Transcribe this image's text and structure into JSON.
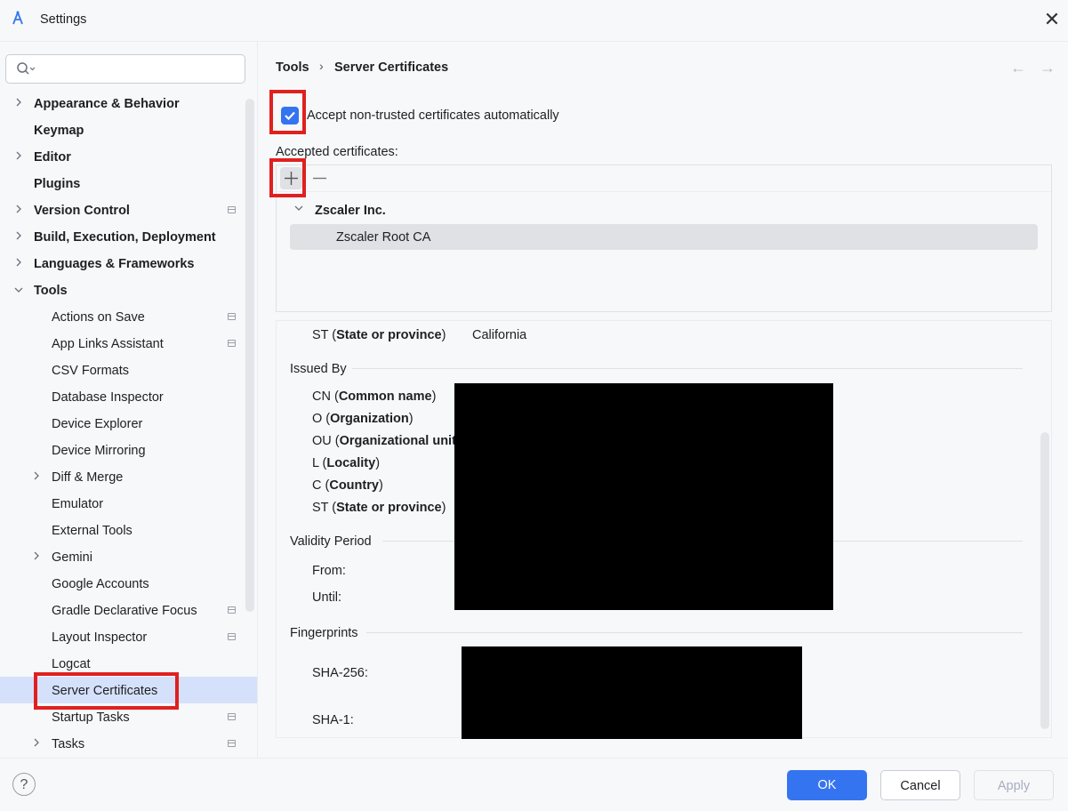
{
  "window": {
    "title": "Settings"
  },
  "search": {
    "placeholder": ""
  },
  "sidebar": {
    "items": [
      {
        "label": "Appearance & Behavior",
        "bold": true,
        "chevron": "right"
      },
      {
        "label": "Keymap",
        "bold": true
      },
      {
        "label": "Editor",
        "bold": true,
        "chevron": "right"
      },
      {
        "label": "Plugins",
        "bold": true
      },
      {
        "label": "Version Control",
        "bold": true,
        "chevron": "right",
        "pinned": true
      },
      {
        "label": "Build, Execution, Deployment",
        "bold": true,
        "chevron": "right"
      },
      {
        "label": "Languages & Frameworks",
        "bold": true,
        "chevron": "right"
      },
      {
        "label": "Tools",
        "bold": true,
        "chevron": "down"
      },
      {
        "label": "Actions on Save",
        "pinned": true
      },
      {
        "label": "App Links Assistant",
        "pinned": true
      },
      {
        "label": "CSV Formats"
      },
      {
        "label": "Database Inspector"
      },
      {
        "label": "Device Explorer"
      },
      {
        "label": "Device Mirroring"
      },
      {
        "label": "Diff & Merge",
        "chevron": "right"
      },
      {
        "label": "Emulator"
      },
      {
        "label": "External Tools"
      },
      {
        "label": "Gemini",
        "chevron": "right"
      },
      {
        "label": "Google Accounts"
      },
      {
        "label": "Gradle Declarative Focus",
        "pinned": true
      },
      {
        "label": "Layout Inspector",
        "pinned": true
      },
      {
        "label": "Logcat"
      },
      {
        "label": "Server Certificates",
        "selected": true
      },
      {
        "label": "Startup Tasks",
        "pinned": true
      },
      {
        "label": "Tasks",
        "chevron": "right",
        "pinned": true
      }
    ]
  },
  "breadcrumb": {
    "parent": "Tools",
    "current": "Server Certificates"
  },
  "options": {
    "accept_untrusted_label": "Accept non-trusted certificates automatically",
    "accept_untrusted_checked": true,
    "accepted_label": "Accepted certificates:"
  },
  "tree": {
    "group": "Zscaler Inc.",
    "leaf": "Zscaler Root CA"
  },
  "details": {
    "subject_st": {
      "key": "ST",
      "name": "State or province",
      "value": "California"
    },
    "issued_by_title": "Issued By",
    "issued_by_fields": [
      {
        "key": "CN",
        "name": "Common name"
      },
      {
        "key": "O",
        "name": "Organization"
      },
      {
        "key": "OU",
        "name": "Organizational unit"
      },
      {
        "key": "L",
        "name": "Locality"
      },
      {
        "key": "C",
        "name": "Country"
      },
      {
        "key": "ST",
        "name": "State or province"
      }
    ],
    "validity_title": "Validity Period",
    "from_label": "From:",
    "until_label": "Until:",
    "fingerprints_title": "Fingerprints",
    "sha256_label": "SHA-256:",
    "sha1_label": "SHA-1:"
  },
  "buttons": {
    "ok": "OK",
    "cancel": "Cancel",
    "apply": "Apply"
  },
  "colors": {
    "accent": "#3574f0",
    "highlight": "#e0201f",
    "redaction": "#000000"
  }
}
